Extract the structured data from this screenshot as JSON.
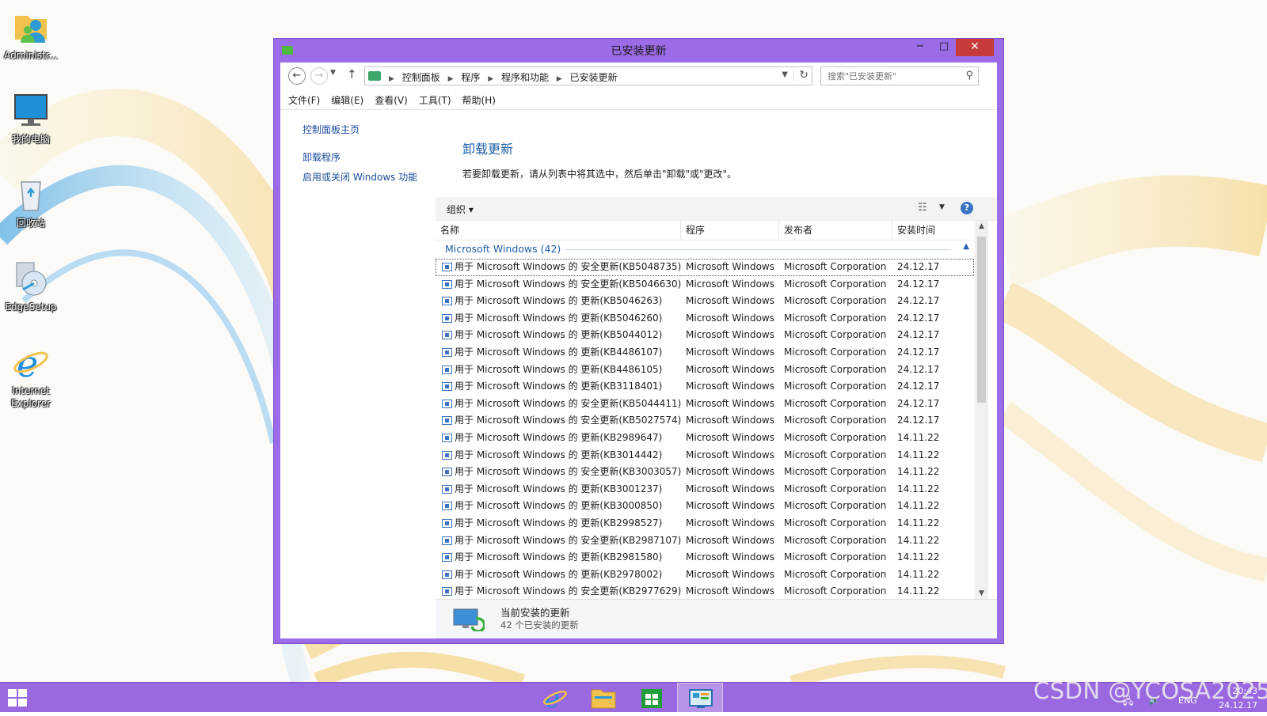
{
  "desktop": {
    "icons": [
      {
        "label": "Administr..."
      },
      {
        "label": "我的电脑"
      },
      {
        "label": "回收站"
      },
      {
        "label": "EdgeSetup"
      },
      {
        "label": "Internet Explorer"
      }
    ]
  },
  "window": {
    "title": "已安装更新",
    "close_glyph": "✕",
    "min_glyph": "−",
    "max_glyph": "□"
  },
  "nav": {
    "back": "←",
    "forward": "→",
    "up": "↑",
    "breadcrumbs": [
      "控制面板",
      "程序",
      "程序和功能",
      "已安装更新"
    ],
    "search_placeholder": "搜索\"已安装更新\""
  },
  "menu": [
    "文件(F)",
    "编辑(E)",
    "查看(V)",
    "工具(T)",
    "帮助(H)"
  ],
  "left_pane": {
    "home": "控制面板主页",
    "uninstall": "卸载程序",
    "features": "启用或关闭 Windows 功能"
  },
  "main": {
    "heading": "卸载更新",
    "instruction": "若要卸载更新，请从列表中将其选中，然后单击\"卸载\"或\"更改\"。",
    "organize": "组织 ▾"
  },
  "columns": {
    "name": "名称",
    "program": "程序",
    "publisher": "发布者",
    "date": "安装时间"
  },
  "group": {
    "label": "Microsoft Windows (42)"
  },
  "rows": [
    {
      "name": "用于 Microsoft Windows 的 安全更新(KB5048735)",
      "program": "Microsoft Windows",
      "publisher": "Microsoft Corporation",
      "date": "24.12.17"
    },
    {
      "name": "用于 Microsoft Windows 的 安全更新(KB5046630)",
      "program": "Microsoft Windows",
      "publisher": "Microsoft Corporation",
      "date": "24.12.17"
    },
    {
      "name": "用于 Microsoft Windows 的 更新(KB5046263)",
      "program": "Microsoft Windows",
      "publisher": "Microsoft Corporation",
      "date": "24.12.17"
    },
    {
      "name": "用于 Microsoft Windows 的 更新(KB5046260)",
      "program": "Microsoft Windows",
      "publisher": "Microsoft Corporation",
      "date": "24.12.17"
    },
    {
      "name": "用于 Microsoft Windows 的 更新(KB5044012)",
      "program": "Microsoft Windows",
      "publisher": "Microsoft Corporation",
      "date": "24.12.17"
    },
    {
      "name": "用于 Microsoft Windows 的 更新(KB4486107)",
      "program": "Microsoft Windows",
      "publisher": "Microsoft Corporation",
      "date": "24.12.17"
    },
    {
      "name": "用于 Microsoft Windows 的 更新(KB4486105)",
      "program": "Microsoft Windows",
      "publisher": "Microsoft Corporation",
      "date": "24.12.17"
    },
    {
      "name": "用于 Microsoft Windows 的 更新(KB3118401)",
      "program": "Microsoft Windows",
      "publisher": "Microsoft Corporation",
      "date": "24.12.17"
    },
    {
      "name": "用于 Microsoft Windows 的 安全更新(KB5044411)",
      "program": "Microsoft Windows",
      "publisher": "Microsoft Corporation",
      "date": "24.12.17"
    },
    {
      "name": "用于 Microsoft Windows 的 安全更新(KB5027574)",
      "program": "Microsoft Windows",
      "publisher": "Microsoft Corporation",
      "date": "24.12.17"
    },
    {
      "name": "用于 Microsoft Windows 的 更新(KB2989647)",
      "program": "Microsoft Windows",
      "publisher": "Microsoft Corporation",
      "date": "14.11.22"
    },
    {
      "name": "用于 Microsoft Windows 的 更新(KB3014442)",
      "program": "Microsoft Windows",
      "publisher": "Microsoft Corporation",
      "date": "14.11.22"
    },
    {
      "name": "用于 Microsoft Windows 的 安全更新(KB3003057)",
      "program": "Microsoft Windows",
      "publisher": "Microsoft Corporation",
      "date": "14.11.22"
    },
    {
      "name": "用于 Microsoft Windows 的 更新(KB3001237)",
      "program": "Microsoft Windows",
      "publisher": "Microsoft Corporation",
      "date": "14.11.22"
    },
    {
      "name": "用于 Microsoft Windows 的 更新(KB3000850)",
      "program": "Microsoft Windows",
      "publisher": "Microsoft Corporation",
      "date": "14.11.22"
    },
    {
      "name": "用于 Microsoft Windows 的 更新(KB2998527)",
      "program": "Microsoft Windows",
      "publisher": "Microsoft Corporation",
      "date": "14.11.22"
    },
    {
      "name": "用于 Microsoft Windows 的 安全更新(KB2987107)",
      "program": "Microsoft Windows",
      "publisher": "Microsoft Corporation",
      "date": "14.11.22"
    },
    {
      "name": "用于 Microsoft Windows 的 更新(KB2981580)",
      "program": "Microsoft Windows",
      "publisher": "Microsoft Corporation",
      "date": "14.11.22"
    },
    {
      "name": "用于 Microsoft Windows 的 更新(KB2978002)",
      "program": "Microsoft Windows",
      "publisher": "Microsoft Corporation",
      "date": "14.11.22"
    },
    {
      "name": "用于 Microsoft Windows 的 安全更新(KB2977629)",
      "program": "Microsoft Windows",
      "publisher": "Microsoft Corporation",
      "date": "14.11.22"
    }
  ],
  "details": {
    "title": "当前安装的更新",
    "count": "42 个已安装的更新"
  },
  "taskbar": {
    "lang": "ENG",
    "time": "20:43",
    "date": "24.12.17"
  },
  "watermark": "CSDN @YCOSA2025",
  "colors": {
    "window_frame": "#9b6be8",
    "taskbar": "#9a68e0",
    "link": "#1a4a9a",
    "heading": "#1e5fa8",
    "close": "#c73b3b"
  }
}
